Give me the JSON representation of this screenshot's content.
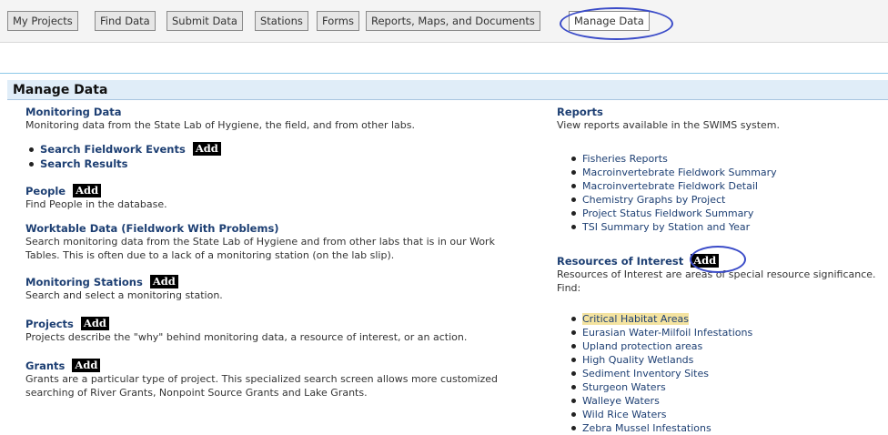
{
  "tabs": [
    {
      "label": "My Projects"
    },
    {
      "label": "Find Data"
    },
    {
      "label": "Submit Data"
    },
    {
      "label": "Stations"
    },
    {
      "label": "Forms"
    },
    {
      "label": "Reports, Maps, and Documents"
    },
    {
      "label": "Manage Data",
      "active": true
    }
  ],
  "main": {
    "title": "Manage Data",
    "add_label": "Add",
    "left": {
      "monitoring": {
        "title": "Monitoring Data",
        "desc": "Monitoring data from the State Lab of Hygiene, the field, and from other labs.",
        "links": [
          "Search Fieldwork Events",
          "Search Results"
        ]
      },
      "people": {
        "title": "People",
        "desc": "Find People in the database."
      },
      "worktable": {
        "title": "Worktable Data (Fieldwork With Problems)",
        "desc": "Search monitoring data from the State Lab of Hygiene and from other labs that is in our Work Tables. This is often due to a lack of a monitoring station (on the lab slip)."
      },
      "stations": {
        "title": "Monitoring Stations",
        "desc": "Search and select a monitoring station."
      },
      "projects": {
        "title": "Projects",
        "desc": "Projects describe the \"why\" behind monitoring data, a resource of interest, or an action."
      },
      "grants": {
        "title": "Grants",
        "desc": "Grants are a particular type of project. This specialized search screen allows more customized searching of River Grants, Nonpoint Source Grants and Lake Grants."
      }
    },
    "right": {
      "reports": {
        "title": "Reports",
        "desc": "View reports available in the SWIMS system.",
        "links": [
          "Fisheries Reports",
          "Macroinvertebrate Fieldwork Summary",
          "Macroinvertebrate Fieldwork Detail",
          "Chemistry Graphs by Project",
          "Project Status Fieldwork Summary",
          "TSI Summary by Station and Year"
        ]
      },
      "resources": {
        "title": "Resources of Interest",
        "desc": "Resources of Interest are areas of special resource significance. Find:",
        "links": [
          "Critical Habitat Areas",
          "Eurasian Water-Milfoil Infestations",
          "Upland protection areas",
          "High Quality Wetlands",
          "Sediment Inventory Sites",
          "Sturgeon Waters",
          "Walleye Waters",
          "Wild Rice Waters",
          "Zebra Mussel Infestations"
        ]
      }
    }
  },
  "colors": {
    "link": "#1d3f73",
    "header_bg": "#e0edf8",
    "oval": "#3a4bc8",
    "highlight": "#f4e3a0"
  }
}
